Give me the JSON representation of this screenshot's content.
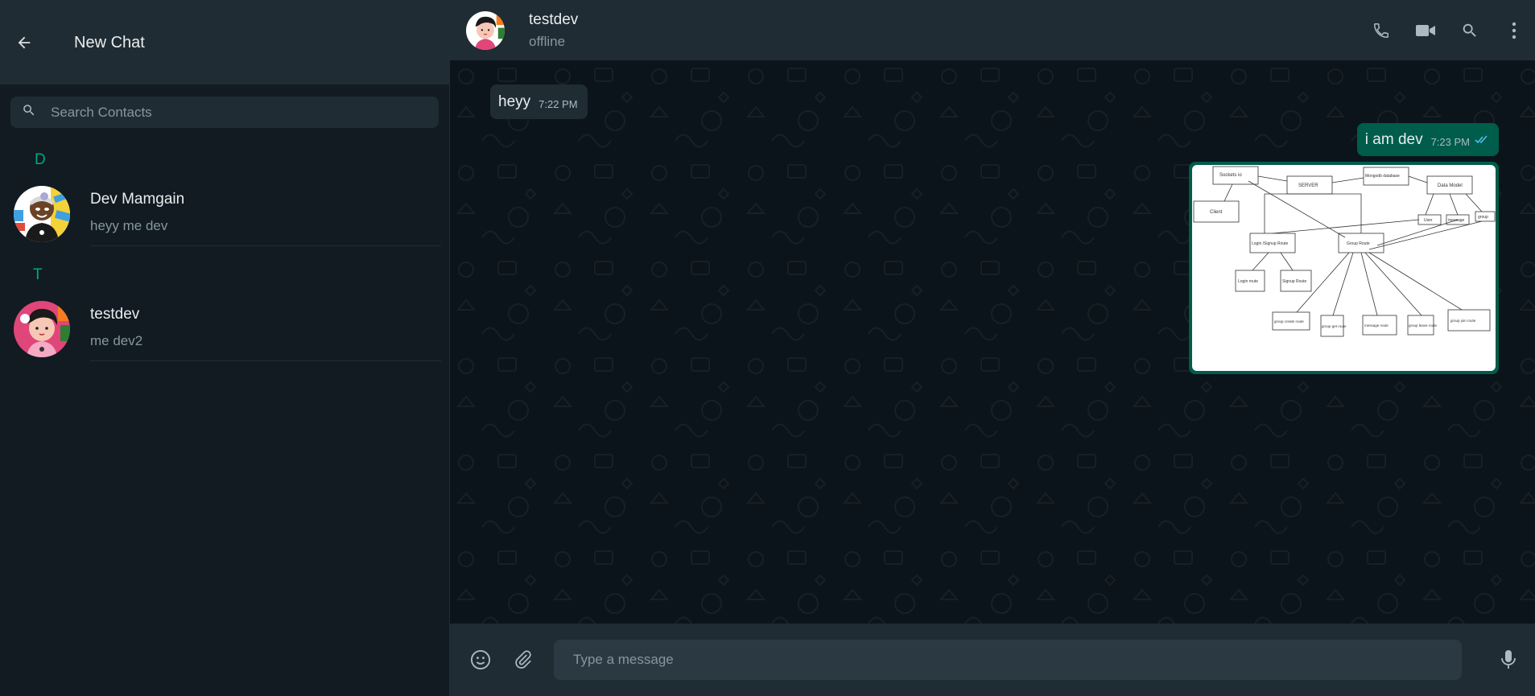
{
  "sidebar": {
    "title": "New Chat",
    "search_placeholder": "Search Contacts",
    "sections": [
      {
        "letter": "D",
        "contacts": [
          {
            "name": "Dev Mamgain",
            "status": "heyy me dev"
          }
        ]
      },
      {
        "letter": "T",
        "contacts": [
          {
            "name": "testdev",
            "status": "me dev2"
          }
        ]
      }
    ]
  },
  "chat": {
    "contact_name": "testdev",
    "contact_status": "offline",
    "messages": [
      {
        "direction": "incoming",
        "text": "heyy",
        "time": "7:22 PM"
      },
      {
        "direction": "outgoing",
        "text": "i am dev",
        "time": "7:23 PM",
        "read": true
      }
    ],
    "image_diagram_labels": {
      "sockets": "Sockets io",
      "server": "SERVER",
      "mongodb": "Mongodb database",
      "data_model": "Data Model",
      "client": "Client",
      "user": "User",
      "message": "message",
      "group": "group",
      "login_signup": "Login /Signup Route",
      "group_route": "Group Route",
      "login_route": "Login route",
      "signup_route": "Signup Route",
      "group_create": "group create route",
      "group_get": "group get route",
      "message_route": "message route",
      "group_leave": "group leave route",
      "group_join": "group join route"
    }
  },
  "composer": {
    "placeholder": "Type a message"
  },
  "colors": {
    "accent": "#00a884",
    "outgoing_bubble": "#005c4b",
    "panel": "#202c33",
    "background": "#111b21",
    "read_ticks": "#53bdeb"
  }
}
